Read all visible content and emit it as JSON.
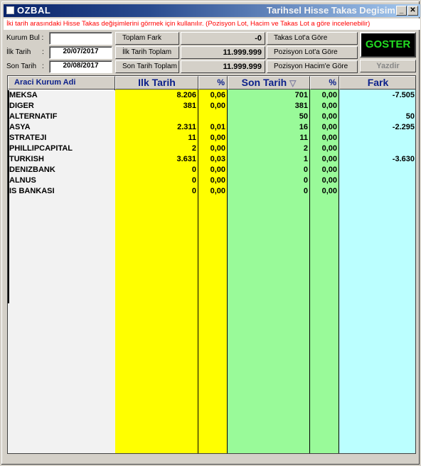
{
  "window": {
    "app_name": "OZBAL",
    "title": "Tarihsel Hisse Takas Degisim",
    "info_text": "İki tarih arasındaki Hisse Takas değişimlerini görmek için kullanılır. (Pozisyon Lot, Hacim ve Takas Lot a göre incelenebilir)"
  },
  "controls": {
    "kurum_bul_label": "Kurum Bul :",
    "kurum_bul_value": "",
    "ilk_tarih_label": "İlk Tarih",
    "ilk_tarih_value": "20/07/2017",
    "son_tarih_label": "Son Tarih",
    "son_tarih_value": "20/08/2017",
    "colon": ":",
    "toplam_fark_label": "Toplam Fark",
    "toplam_fark_value": "-0",
    "ilk_tarih_toplam_label": "İlk Tarih Toplam",
    "ilk_tarih_toplam_value": "11.999.999",
    "son_tarih_toplam_label": "Son Tarih Toplam",
    "son_tarih_toplam_value": "11.999.999",
    "takas_lot_btn": "Takas Lot'a Göre",
    "pozisyon_lot_btn": "Pozisyon Lot'a Göre",
    "pozisyon_hacim_btn": "Pozisyon Hacim'e Göre",
    "goster_btn": "GOSTER",
    "yazdir_btn": "Yazdir"
  },
  "grid": {
    "headers": {
      "kurum": "Araci Kurum Adi",
      "ilk_tarih": "Ilk Tarih",
      "pct1": "%",
      "son_tarih": "Son Tarih",
      "sort_icon": "▽",
      "pct2": "%",
      "fark": "Fark"
    },
    "rows": [
      {
        "name": "MEKSA",
        "ilk": "8.206",
        "p1": "0,06",
        "son": "701",
        "p2": "0,00",
        "fark": "-7.505"
      },
      {
        "name": "DIGER",
        "ilk": "381",
        "p1": "0,00",
        "son": "381",
        "p2": "0,00",
        "fark": ""
      },
      {
        "name": "ALTERNATIF",
        "ilk": "",
        "p1": "",
        "son": "50",
        "p2": "0,00",
        "fark": "50"
      },
      {
        "name": "ASYA",
        "ilk": "2.311",
        "p1": "0,01",
        "son": "16",
        "p2": "0,00",
        "fark": "-2.295"
      },
      {
        "name": "STRATEJI",
        "ilk": "11",
        "p1": "0,00",
        "son": "11",
        "p2": "0,00",
        "fark": ""
      },
      {
        "name": "PHILLIPCAPITAL",
        "ilk": "2",
        "p1": "0,00",
        "son": "2",
        "p2": "0,00",
        "fark": ""
      },
      {
        "name": "TURKISH",
        "ilk": "3.631",
        "p1": "0,03",
        "son": "1",
        "p2": "0,00",
        "fark": "-3.630"
      },
      {
        "name": "DENIZBANK",
        "ilk": "0",
        "p1": "0,00",
        "son": "0",
        "p2": "0,00",
        "fark": ""
      },
      {
        "name": "ALNUS",
        "ilk": "0",
        "p1": "0,00",
        "son": "0",
        "p2": "0,00",
        "fark": ""
      },
      {
        "name": "IS BANKASI",
        "ilk": "0",
        "p1": "0,00",
        "son": "0",
        "p2": "0,00",
        "fark": ""
      }
    ]
  },
  "colors": {
    "col_kurum": "#ffffff",
    "col_ilk": "#ffff00",
    "col_son": "#99fa99",
    "col_fark": "#bbffff",
    "goster_text": "#22dd22",
    "info_text": "#ff0000"
  }
}
